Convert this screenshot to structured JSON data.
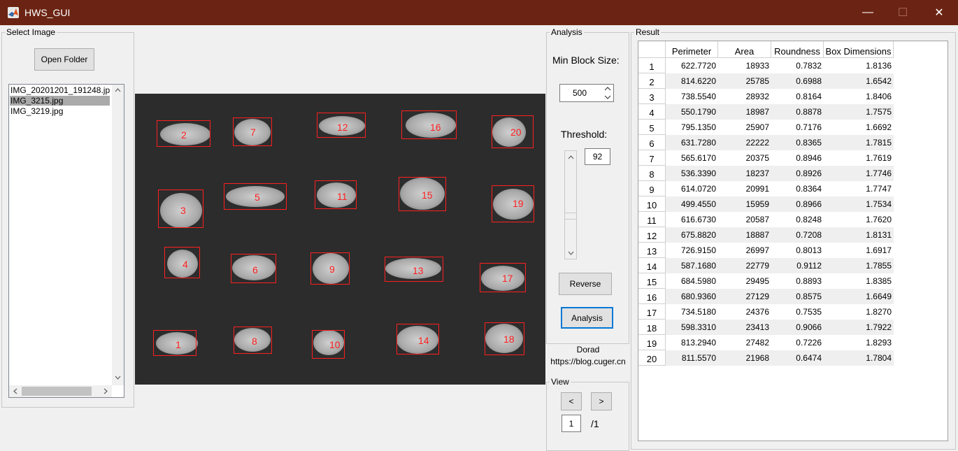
{
  "window": {
    "title": "HWS_GUI",
    "minimize": "—",
    "maximize": "☐",
    "close": "✕"
  },
  "select_panel": {
    "title": "Select Image",
    "open_button": "Open Folder",
    "files": [
      "IMG_20201201_191248.jpg",
      "IMG_3215.jpg",
      "IMG_3219.jpg"
    ],
    "selected_index": 1
  },
  "analysis_panel": {
    "title": "Analysis",
    "min_block_label": "Min Block Size:",
    "min_block_value": "500",
    "threshold_label": "Threshold:",
    "threshold_value": "92",
    "reverse_button": "Reverse",
    "analysis_button": "Analysis",
    "credit_name": "Dorad",
    "credit_url": "https://blog.cuger.cn"
  },
  "view_panel": {
    "title": "View",
    "prev_button": "<",
    "next_button": ">",
    "page_value": "1",
    "page_total": "/1"
  },
  "result_panel": {
    "title": "Result",
    "columns": [
      "Perimeter",
      "Area",
      "Roundness",
      "Box Dimensions"
    ],
    "rows": [
      [
        "1",
        "622.7720",
        "18933",
        "0.7832",
        "1.8136"
      ],
      [
        "2",
        "814.6220",
        "25785",
        "0.6988",
        "1.6542"
      ],
      [
        "3",
        "738.5540",
        "28932",
        "0.8164",
        "1.8406"
      ],
      [
        "4",
        "550.1790",
        "18987",
        "0.8878",
        "1.7575"
      ],
      [
        "5",
        "795.1350",
        "25907",
        "0.7176",
        "1.6692"
      ],
      [
        "6",
        "631.7280",
        "22222",
        "0.8365",
        "1.7815"
      ],
      [
        "7",
        "565.6170",
        "20375",
        "0.8946",
        "1.7619"
      ],
      [
        "8",
        "536.3390",
        "18237",
        "0.8926",
        "1.7746"
      ],
      [
        "9",
        "614.0720",
        "20991",
        "0.8364",
        "1.7747"
      ],
      [
        "10",
        "499.4550",
        "15959",
        "0.8966",
        "1.7534"
      ],
      [
        "11",
        "616.6730",
        "20587",
        "0.8248",
        "1.7620"
      ],
      [
        "12",
        "675.8820",
        "18887",
        "0.7208",
        "1.8131"
      ],
      [
        "13",
        "726.9150",
        "26997",
        "0.8013",
        "1.6917"
      ],
      [
        "14",
        "587.1680",
        "22779",
        "0.9112",
        "1.7855"
      ],
      [
        "15",
        "684.5980",
        "29495",
        "0.8893",
        "1.8385"
      ],
      [
        "16",
        "680.9360",
        "27129",
        "0.8575",
        "1.6649"
      ],
      [
        "17",
        "734.5180",
        "24376",
        "0.7535",
        "1.8270"
      ],
      [
        "18",
        "598.3310",
        "23413",
        "0.9066",
        "1.7922"
      ],
      [
        "19",
        "813.2940",
        "27482",
        "0.7226",
        "1.8293"
      ],
      [
        "20",
        "811.5570",
        "21968",
        "0.6474",
        "1.7804"
      ]
    ]
  },
  "image_labels": [
    "1",
    "2",
    "3",
    "4",
    "5",
    "6",
    "7",
    "8",
    "9",
    "10",
    "11",
    "12",
    "13",
    "14",
    "15",
    "16",
    "17",
    "18",
    "19",
    "20"
  ],
  "colors": {
    "titlebar": "#6b2413",
    "box": "#ff1f1f"
  }
}
